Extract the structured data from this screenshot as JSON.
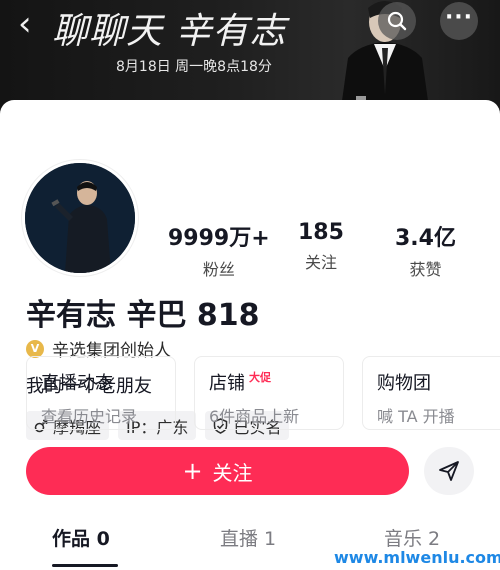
{
  "banner": {
    "title": "聊聊天 辛有志",
    "subtitle": "8月18日 周一晚8点18分"
  },
  "stats": [
    {
      "value": "9999万+",
      "label": "粉丝"
    },
    {
      "value": "185",
      "label": "关注"
    },
    {
      "value": "3.4亿",
      "label": "获赞"
    }
  ],
  "profile": {
    "name": "辛有志 辛巴 818",
    "verification": "辛选集团创始人",
    "bio": "我的一个老朋友"
  },
  "tags": [
    {
      "icon": "male-icon",
      "label": "摩羯座"
    },
    {
      "label": "IP：广东"
    },
    {
      "icon": "shield-check-icon",
      "label": "已实名"
    }
  ],
  "tiles": [
    {
      "title": "直播动态",
      "subtitle": "查看历史记录"
    },
    {
      "title": "店铺",
      "badge": "大促",
      "subtitle": "6件商品上新"
    },
    {
      "title": "购物团",
      "subtitle": "喊 TA 开播"
    }
  ],
  "actions": {
    "follow_icon": "+",
    "follow_label": "关注"
  },
  "tabs": [
    {
      "label": "作品 0",
      "active": true
    },
    {
      "label": "直播 1",
      "active": false
    },
    {
      "label": "音乐 2",
      "active": false
    }
  ],
  "watermark": "www.mlwenlu.com",
  "colors": {
    "accent": "#fe2c55",
    "badge_gold": "#e8b84a",
    "watermark": "#1e88e5"
  }
}
